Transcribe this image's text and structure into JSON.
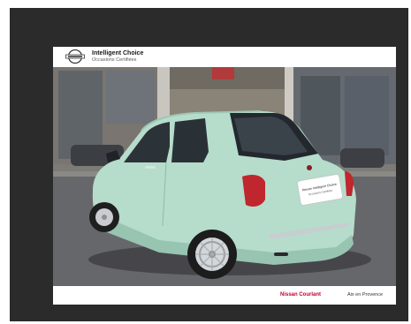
{
  "header": {
    "logo_icon": "nissan-logo-icon",
    "brand_title": "Intelligent Choice",
    "brand_subtitle": "Occasions Certifiées"
  },
  "photo": {
    "plate_line1": "Nissan Intelligent Choice",
    "plate_line2": "Occasions Certifiées"
  },
  "footer": {
    "dealer_name": "Nissan Courlant",
    "dealer_city": "Aix en Provence"
  },
  "colors": {
    "frame": "#2b2b2b",
    "car_body": "#b6dccb",
    "accent": "#c3002f"
  }
}
